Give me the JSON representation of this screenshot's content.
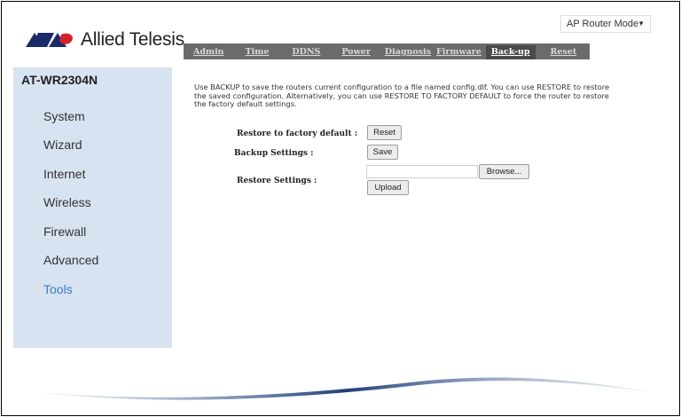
{
  "brand": {
    "name": "Allied Telesis"
  },
  "mode_select": {
    "value": "AP Router Mode"
  },
  "tabs": [
    {
      "label": "Admin",
      "active": false
    },
    {
      "label": "Time",
      "active": false
    },
    {
      "label": "DDNS",
      "active": false
    },
    {
      "label": "Power",
      "active": false
    },
    {
      "label": "Diagnosis",
      "active": false
    },
    {
      "label": "Firmware",
      "active": false
    },
    {
      "label": "Back-up",
      "active": true
    },
    {
      "label": "Reset",
      "active": false
    }
  ],
  "sidebar": {
    "model": "AT-WR2304N",
    "items": [
      {
        "label": "System"
      },
      {
        "label": "Wizard"
      },
      {
        "label": "Internet"
      },
      {
        "label": "Wireless"
      },
      {
        "label": "Firewall"
      },
      {
        "label": "Advanced"
      },
      {
        "label": "Tools",
        "active": true
      }
    ]
  },
  "main": {
    "description": "Use BACKUP to save the routers current configuration to a file named config.dlf. You can use RESTORE to restore the saved configuration. Alternatively, you can use RESTORE TO FACTORY DEFAULT to force the router to restore the factory default settings.",
    "factory_label": "Restore to factory default :",
    "factory_button": "Reset",
    "backup_label": "Backup Settings :",
    "backup_button": "Save",
    "restore_label": "Restore Settings :",
    "restore_file_value": "",
    "browse_button": "Browse...",
    "upload_button": "Upload"
  },
  "colors": {
    "sidebar_bg": "#d7e3f1",
    "tab_bar": "#6b6b6b",
    "active_nav": "#3b7bc6",
    "logo_red": "#d4202a",
    "logo_blue": "#1b2a6b"
  }
}
